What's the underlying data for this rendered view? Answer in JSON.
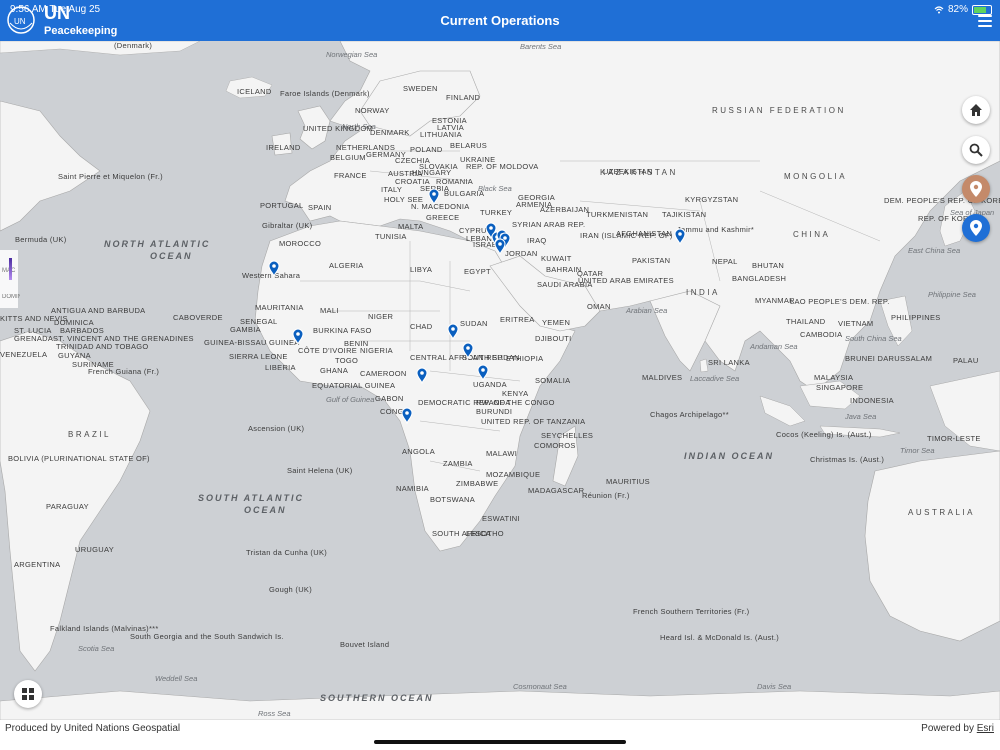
{
  "status_bar": {
    "time": "9:56 AM",
    "date": "Tue Aug 25",
    "battery": "82%"
  },
  "header": {
    "logo_un": "UN",
    "logo_emblem_text": "UN",
    "logo_sub": "Peacekeeping",
    "title": "Current Operations"
  },
  "map": {
    "regions": [
      "RUSSIAN FEDERATION",
      "KAZAKHSTAN",
      "MONGOLIA",
      "CHINA",
      "INDIA",
      "BRAZIL",
      "AUSTRALIA"
    ],
    "oceans": [
      "NORTH ATLANTIC OCEAN",
      "SOUTH ATLANTIC OCEAN",
      "INDIAN OCEAN",
      "SOUTHERN OCEAN"
    ],
    "seas": [
      "Norwegian Sea",
      "Barents Sea",
      "North Sea",
      "Black Sea",
      "Arabian Sea",
      "Laccadive Sea",
      "Andaman Sea",
      "South China Sea",
      "Philippine Sea",
      "Java Sea",
      "Timor Sea",
      "Gulf of Guinea",
      "Scotia Sea",
      "Weddell Sea",
      "Cosmonaut Sea",
      "Davis Sea",
      "Ross Sea",
      "Sea of Japan",
      "East China Sea"
    ],
    "countries": [
      "(Denmark)",
      "ICELAND",
      "Faroe Islands (Denmark)",
      "NORWAY",
      "SWEDEN",
      "FINLAND",
      "UNITED KINGDOM",
      "DENMARK",
      "ESTONIA",
      "LATVIA",
      "LITHUANIA",
      "IRELAND",
      "NETHERLANDS",
      "GERMANY",
      "BELGIUM",
      "POLAND",
      "BELARUS",
      "CZECHIA",
      "SLOVAKIA",
      "UKRAINE",
      "REP. OF MOLDOVA",
      "AUSTRIA",
      "HUNGARY",
      "ROMANIA",
      "FRANCE",
      "CROATIA",
      "SERBIA",
      "ITALY",
      "BULGARIA",
      "HOLY SEE",
      "N. MACEDONIA",
      "GREECE",
      "PORTUGAL",
      "SPAIN",
      "TURKEY",
      "GEORGIA",
      "ARMENIA",
      "AZERBAIJAN",
      "Saint Pierre et Miquelon (Fr.)",
      "Bermuda (UK)",
      "Gibraltar (UK)",
      "MALTA",
      "TUNISIA",
      "MOROCCO",
      "ALGERIA",
      "LIBYA",
      "EGYPT",
      "CYPRUS",
      "LEBANON",
      "ISRAEL",
      "SYRIAN ARAB REP.",
      "IRAQ",
      "JORDAN",
      "IRAN (ISLAMIC REP. OF)",
      "KUWAIT",
      "BAHRAIN",
      "QATAR",
      "UNITED ARAB EMIRATES",
      "SAUDI ARABIA",
      "OMAN",
      "YEMEN",
      "UZBEKISTAN",
      "TURKMENISTAN",
      "TAJIKISTAN",
      "KYRGYZSTAN",
      "AFGHANISTAN",
      "PAKISTAN",
      "Jammu and Kashmir*",
      "NEPAL",
      "BHUTAN",
      "BANGLADESH",
      "MYANMAR",
      "LAO PEOPLE'S DEM. REP.",
      "THAILAND",
      "VIETNAM",
      "CAMBODIA",
      "PHILIPPINES",
      "BRUNEI DARUSSALAM",
      "MALAYSIA",
      "SINGAPORE",
      "INDONESIA",
      "TIMOR-LESTE",
      "PALAU",
      "DEM. PEOPLE'S REP. OF KOREA",
      "REP. OF KOREA",
      "SRI LANKA",
      "MALDIVES",
      "Chagos Archipelago**",
      "Cocos (Keeling) Is. (Aust.)",
      "Christmas Is. (Aust.)",
      "Western Sahara",
      "MAURITANIA",
      "MALI",
      "NIGER",
      "CHAD",
      "SUDAN",
      "ERITREA",
      "DJIBOUTI",
      "ETHIOPIA",
      "SOMALIA",
      "SENEGAL",
      "GAMBIA",
      "GUINEA-BISSAU",
      "GUINEA",
      "SIERRA LEONE",
      "LIBERIA",
      "CÔTE D'IVOIRE",
      "BURKINA FASO",
      "GHANA",
      "TOGO",
      "BENIN",
      "NIGERIA",
      "CAMEROON",
      "EQUATORIAL GUINEA",
      "GABON",
      "CONGO",
      "CENTRAL AFRICAN REP.",
      "SOUTH SUDAN",
      "UGANDA",
      "KENYA",
      "RWANDA",
      "BURUNDI",
      "DEMOCRATIC REP. OF THE CONGO",
      "UNITED REP. OF TANZANIA",
      "SEYCHELLES",
      "COMOROS",
      "ANGOLA",
      "ZAMBIA",
      "MALAWI",
      "MOZAMBIQUE",
      "ZIMBABWE",
      "NAMIBIA",
      "BOTSWANA",
      "MADAGASCAR",
      "MAURITIUS",
      "Réunion (Fr.)",
      "ESWATINI",
      "LESOTHO",
      "SOUTH AFRICA",
      "CABOVERDE",
      "ANTIGUA AND BARBUDA",
      "DOMINICA",
      "BARBADOS",
      "ST. LUCIA",
      "ST. VINCENT AND THE GRENADINES",
      "TRINIDAD AND TOBAGO",
      "GRENADA",
      "VENEZUELA",
      "GUYANA",
      "SURINAME",
      "French Guiana (Fr.)",
      "Ascension (UK)",
      "Saint Helena (UK)",
      "BOLIVIA (PLURINATIONAL STATE OF)",
      "PARAGUAY",
      "URUGUAY",
      "ARGENTINA",
      "Tristan da Cunha (UK)",
      "Gough (UK)",
      "Falkland Islands (Malvinas)***",
      "South Georgia and the South Sandwich Is.",
      "Bouvet Island",
      "French Southern Territories (Fr.)",
      "Heard Isl. & McDonald Is. (Aust.)",
      "KITTS AND NEVIS"
    ],
    "mission_markers": 15
  },
  "legend": {
    "label_top": "MAC",
    "label_bottom": "DOMINICAN REP."
  },
  "controls": {
    "home": "home-icon",
    "search": "search-icon",
    "locate": "location-pin-icon",
    "mission": "mission-pin-icon",
    "basemap": "grid-icon"
  },
  "footer": {
    "credit_left": "Produced by United Nations Geospatial",
    "credit_right_prefix": "Powered by ",
    "credit_right_link": "Esri"
  }
}
